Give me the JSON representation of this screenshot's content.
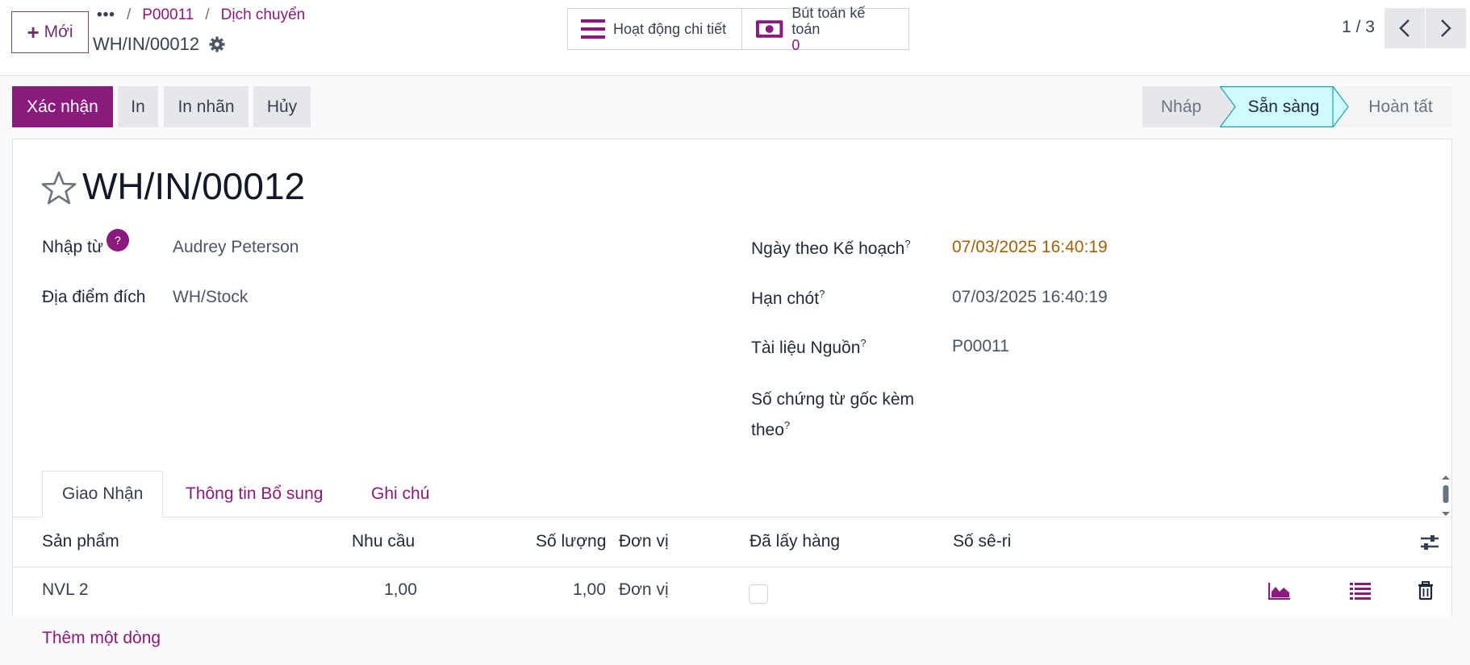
{
  "control_panel": {
    "new_button": "Mới",
    "breadcrumb": {
      "more": "•••",
      "sep": "/",
      "parent1": "P00011",
      "parent2": "Dịch chuyển"
    },
    "record_name": "WH/IN/00012",
    "stat_buttons": [
      {
        "label": "Hoạt động chi tiết"
      },
      {
        "label": "Bút toán kế toán",
        "value": "0"
      }
    ],
    "pager": "1 / 3"
  },
  "actions": {
    "confirm": "Xác nhận",
    "print": "In",
    "print_labels": "In nhãn",
    "cancel": "Hủy"
  },
  "stages": {
    "draft": "Nháp",
    "ready": "Sẵn sàng",
    "done": "Hoàn tất",
    "active": "ready"
  },
  "form": {
    "title": "WH/IN/00012",
    "receive_from_label": "Nhập từ",
    "help_badge": "?",
    "receive_from": "Audrey Peterson",
    "destination_label": "Địa điểm đích",
    "destination": "WH/Stock",
    "scheduled_label": "Ngày theo Kế hoạch",
    "scheduled": "07/03/2025 16:40:19",
    "deadline_label": "Hạn chót",
    "deadline": "07/03/2025 16:40:19",
    "source_label": "Tài liệu Nguồn",
    "source": "P00011",
    "origin_doc_label_1": "Số chứng từ gốc kèm",
    "origin_doc_label_2": "theo",
    "help_mark": "?"
  },
  "tabs": [
    "Giao Nhận",
    "Thông tin Bổ sung",
    "Ghi chú"
  ],
  "table": {
    "headers": {
      "product": "Sản phẩm",
      "demand": "Nhu cầu",
      "quantity": "Số lượng",
      "uom": "Đơn vị",
      "picked": "Đã lấy hàng",
      "serial": "Số sê-ri"
    },
    "rows": [
      {
        "product": "NVL 2",
        "demand": "1,00",
        "quantity": "1,00",
        "uom": "Đơn vị",
        "picked": false
      }
    ],
    "add_line": "Thêm một dòng"
  },
  "colors": {
    "brand": "#8a1a7c",
    "stage_active": "#cffafe",
    "scheduled_date": "#a16207"
  }
}
